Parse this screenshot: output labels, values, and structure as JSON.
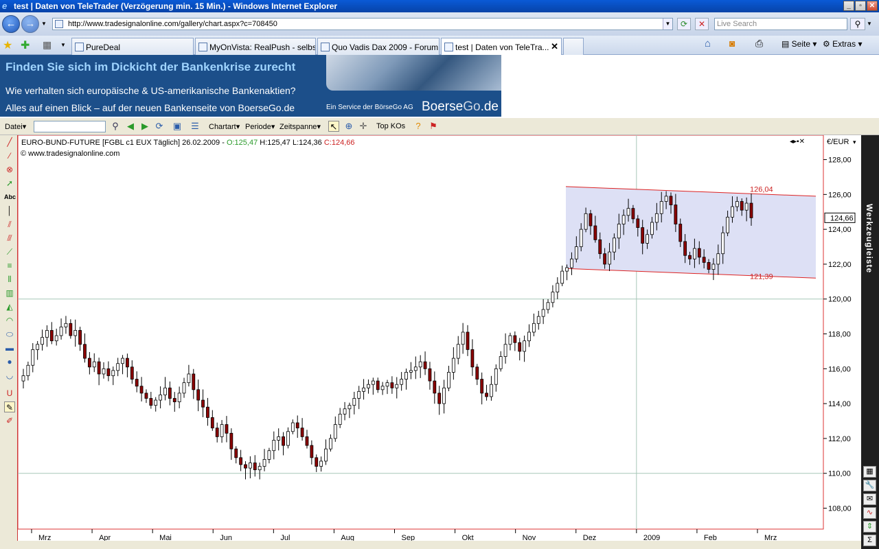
{
  "window": {
    "title": "test | Daten von TeleTrader (Verzögerung min. 15 Min.) - Windows Internet Explorer",
    "icon": "ie-icon"
  },
  "browser": {
    "url": "http://www.tradesignalonline.com/gallery/chart.aspx?c=708450",
    "search_placeholder": "Live Search",
    "tabs": [
      {
        "label": "PureDeal"
      },
      {
        "label": "MyOnVista: RealPush - selbs..."
      },
      {
        "label": "Quo Vadis Dax 2009 - Forum..."
      },
      {
        "label": "test | Daten von TeleTra..."
      }
    ],
    "commands": {
      "page": "Seite",
      "extras": "Extras"
    }
  },
  "banner": {
    "line1": "Finden Sie sich im Dickicht der Bankenkrise zurecht",
    "line2": "Wie verhalten sich  europäische & US-amerikanische Bankenaktien?",
    "line3": "Alles auf einen Blick – auf der neuen Bankenseite von BoerseGo.de",
    "service": "Ein Service der BörseGo AG",
    "logo_a": "Boerse",
    "logo_b": "Go",
    ".de": ".de"
  },
  "toolbar": {
    "file": "Datei",
    "charttype": "Chartart",
    "period": "Periode",
    "timespan": "Zeitspanne",
    "topkos": "Top KOs"
  },
  "sidebar_right": {
    "label": "Werkzeugleiste"
  },
  "chart_data": {
    "type": "candlestick",
    "header": "EURO-BUND-FUTURE [FGBL c1 EUX  Täglich] 26.02.2009 - ",
    "ohlc_open": "O:125,47",
    "ohlc_hl": " H:125,47 L:124,36 ",
    "ohlc_close": "C:124,66",
    "copyright": "© www.tradesignalonline.com",
    "currency": "€/EUR",
    "last_price": "124,66",
    "y_ticks": [
      "128,00",
      "126,00",
      "124,00",
      "122,00",
      "120,00",
      "118,00",
      "116,00",
      "114,00",
      "112,00",
      "110,00",
      "108,00"
    ],
    "y_values": [
      128,
      126,
      124,
      122,
      120,
      118,
      116,
      114,
      112,
      110,
      108
    ],
    "ylim": [
      106.8,
      129.4
    ],
    "x_ticks": [
      "Mrz",
      "Apr",
      "Mai",
      "Jun",
      "Jul",
      "Aug",
      "Sep",
      "Okt",
      "Nov",
      "Dez",
      "2009",
      "Feb",
      "Mrz"
    ],
    "channel": {
      "upper_label": "126,04",
      "lower_label": "121,39"
    },
    "close_series": [
      115.6,
      116.2,
      117.1,
      117.4,
      117.8,
      118.2,
      117.6,
      117.9,
      118.4,
      118.6,
      117.9,
      118.2,
      117.4,
      116.6,
      116.1,
      116.4,
      115.7,
      116.0,
      115.6,
      115.9,
      116.3,
      116.6,
      116.1,
      115.4,
      115.0,
      114.6,
      114.3,
      113.9,
      114.2,
      114.5,
      114.9,
      114.3,
      114.1,
      114.6,
      115.2,
      115.7,
      114.8,
      114.2,
      113.8,
      113.2,
      112.6,
      112.1,
      112.8,
      112.3,
      111.4,
      110.9,
      110.5,
      110.3,
      110.6,
      110.2,
      110.4,
      110.8,
      111.3,
      111.9,
      112.1,
      111.6,
      112.4,
      112.9,
      112.6,
      112.1,
      111.6,
      110.9,
      110.4,
      110.7,
      111.4,
      112.0,
      112.8,
      113.4,
      113.7,
      113.9,
      114.3,
      114.7,
      114.9,
      115.1,
      115.3,
      114.8,
      115.0,
      115.2,
      114.9,
      115.1,
      115.4,
      115.8,
      115.9,
      116.1,
      116.4,
      116.0,
      115.3,
      114.6,
      114.0,
      114.9,
      115.8,
      116.6,
      117.4,
      118.1,
      117.1,
      116.1,
      115.4,
      114.6,
      114.4,
      115.1,
      116.0,
      116.7,
      117.4,
      117.9,
      117.5,
      117.0,
      117.6,
      118.1,
      118.6,
      119.0,
      119.4,
      119.8,
      120.4,
      120.9,
      121.6,
      121.8,
      122.3,
      123.0,
      124.0,
      124.9,
      124.2,
      123.4,
      122.6,
      122.0,
      122.7,
      123.5,
      124.3,
      124.8,
      125.2,
      124.6,
      124.1,
      123.2,
      123.7,
      124.4,
      124.9,
      125.6,
      125.9,
      125.4,
      124.3,
      123.3,
      122.5,
      122.3,
      122.9,
      122.4,
      122.1,
      121.7,
      122.0,
      122.6,
      123.8,
      124.7,
      125.3,
      125.6,
      125.1,
      125.5,
      124.66
    ]
  }
}
